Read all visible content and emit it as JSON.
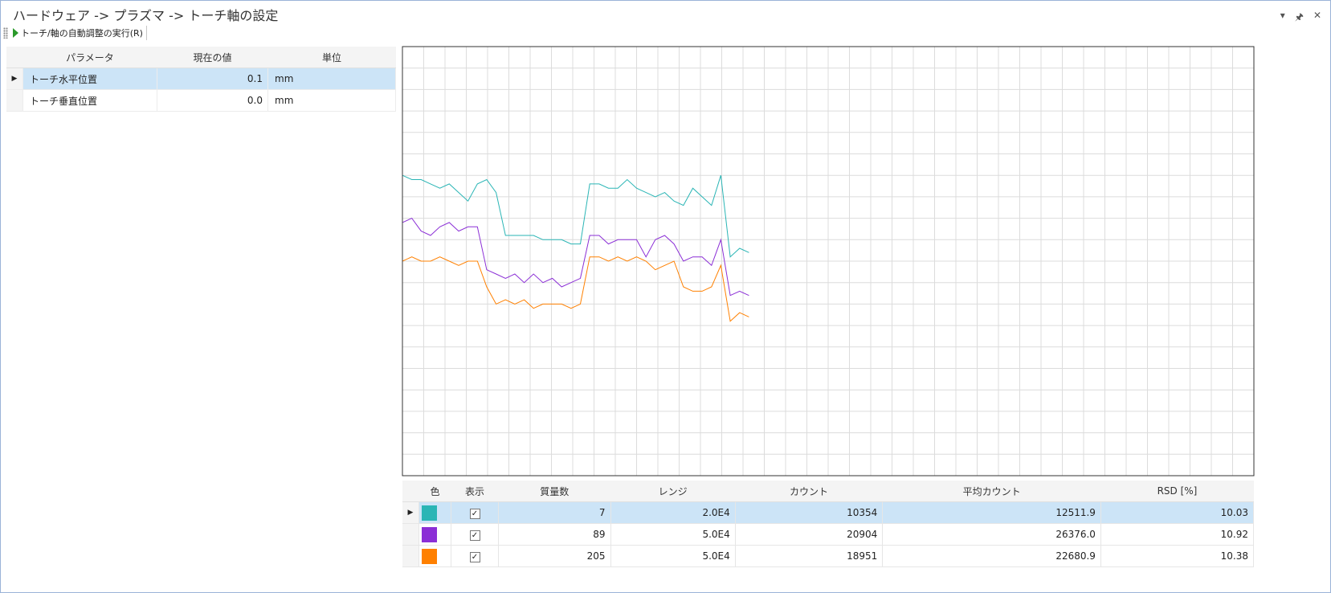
{
  "window": {
    "title": "ハードウェア -> プラズマ -> トーチ軸の設定",
    "controls": [
      "▾",
      "🖈",
      "✕"
    ]
  },
  "toolbar": {
    "run_label": "トーチ/軸の自動調整の実行(R)"
  },
  "params": {
    "headers": {
      "name": "パラメータ",
      "value": "現在の値",
      "unit": "単位"
    },
    "rows": [
      {
        "name": "トーチ水平位置",
        "value": "0.1",
        "unit": "mm",
        "selected": true
      },
      {
        "name": "トーチ垂直位置",
        "value": "0.0",
        "unit": "mm",
        "selected": false
      }
    ]
  },
  "chart_data": {
    "type": "line",
    "grid": true,
    "xlim": [
      0,
      500
    ],
    "ylim": [
      0,
      100
    ],
    "series": [
      {
        "color": "#2ab5b5",
        "values": [
          70,
          69,
          69,
          68,
          67,
          68,
          66,
          64,
          68,
          69,
          66,
          56,
          56,
          56,
          56,
          55,
          55,
          55,
          54,
          54,
          68,
          68,
          67,
          67,
          69,
          67,
          66,
          65,
          66,
          64,
          63,
          67,
          65,
          63,
          70,
          51,
          53,
          52
        ]
      },
      {
        "color": "#8b2fd6",
        "values": [
          59,
          60,
          57,
          56,
          58,
          59,
          57,
          58,
          58,
          48,
          47,
          46,
          47,
          45,
          47,
          45,
          46,
          44,
          45,
          46,
          56,
          56,
          54,
          55,
          55,
          55,
          51,
          55,
          56,
          54,
          50,
          51,
          51,
          49,
          55,
          42,
          43,
          42
        ]
      },
      {
        "color": "#ff8000",
        "values": [
          50,
          51,
          50,
          50,
          51,
          50,
          49,
          50,
          50,
          44,
          40,
          41,
          40,
          41,
          39,
          40,
          40,
          40,
          39,
          40,
          51,
          51,
          50,
          51,
          50,
          51,
          50,
          48,
          49,
          50,
          44,
          43,
          43,
          44,
          49,
          36,
          38,
          37
        ]
      }
    ]
  },
  "mass_table": {
    "headers": [
      "色",
      "表示",
      "質量数",
      "レンジ",
      "カウント",
      "平均カウント",
      "RSD [%]"
    ],
    "rows": [
      {
        "color": "#2ab5b5",
        "shown": true,
        "mass": "7",
        "range": "2.0E4",
        "count": "10354",
        "avg": "12511.9",
        "rsd": "10.03",
        "selected": true
      },
      {
        "color": "#8b2fd6",
        "shown": true,
        "mass": "89",
        "range": "5.0E4",
        "count": "20904",
        "avg": "26376.0",
        "rsd": "10.92",
        "selected": false
      },
      {
        "color": "#ff8000",
        "shown": true,
        "mass": "205",
        "range": "5.0E4",
        "count": "18951",
        "avg": "22680.9",
        "rsd": "10.38",
        "selected": false
      }
    ]
  },
  "icons": {
    "row_indicator": "triangle-right-icon",
    "check": "✓"
  }
}
